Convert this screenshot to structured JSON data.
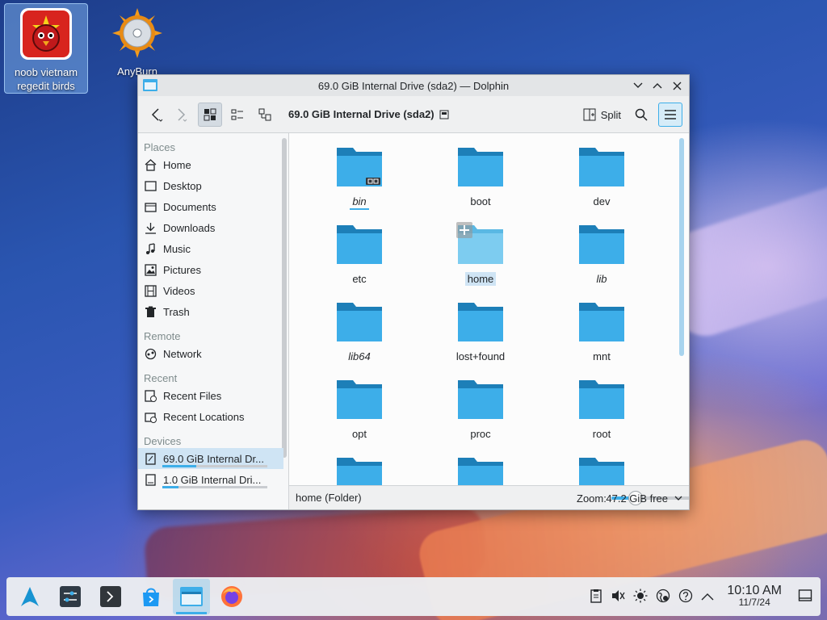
{
  "desktop": {
    "icons": [
      {
        "label": "noob vietnam regedit birds"
      },
      {
        "label": "AnyBurn"
      }
    ]
  },
  "window": {
    "title": "69.0 GiB Internal Drive (sda2) — Dolphin",
    "breadcrumb": "69.0 GiB Internal Drive (sda2)",
    "split_label": "Split"
  },
  "places": {
    "sections": {
      "places": "Places",
      "remote": "Remote",
      "recent": "Recent",
      "devices": "Devices"
    },
    "places_items": [
      "Home",
      "Desktop",
      "Documents",
      "Downloads",
      "Music",
      "Pictures",
      "Videos",
      "Trash"
    ],
    "remote_items": [
      "Network"
    ],
    "recent_items": [
      "Recent Files",
      "Recent Locations"
    ],
    "devices": [
      {
        "label": "69.0 GiB Internal Dr...",
        "usage": 0.32
      },
      {
        "label": "1.0 GiB Internal Dri...",
        "usage": 0.15
      }
    ]
  },
  "files": [
    {
      "name": "bin",
      "italic": true,
      "symlink": true
    },
    {
      "name": "boot"
    },
    {
      "name": "dev"
    },
    {
      "name": "etc"
    },
    {
      "name": "home",
      "hovered": true
    },
    {
      "name": "lib",
      "italic": true
    },
    {
      "name": "lib64",
      "italic": true
    },
    {
      "name": "lost+found"
    },
    {
      "name": "mnt"
    },
    {
      "name": "opt"
    },
    {
      "name": "proc"
    },
    {
      "name": "root"
    },
    {
      "name": ""
    },
    {
      "name": ""
    },
    {
      "name": ""
    }
  ],
  "statusbar": {
    "selection": "home (Folder)",
    "zoom_label": "Zoom:",
    "zoom_level": 0.25,
    "free_space": "47.2 GiB free"
  },
  "taskbar": {
    "time": "10:10 AM",
    "date": "11/7/24"
  },
  "colors": {
    "accent": "#3daee9",
    "folder": "#3daee9",
    "folder_dark": "#1d7fb8"
  }
}
